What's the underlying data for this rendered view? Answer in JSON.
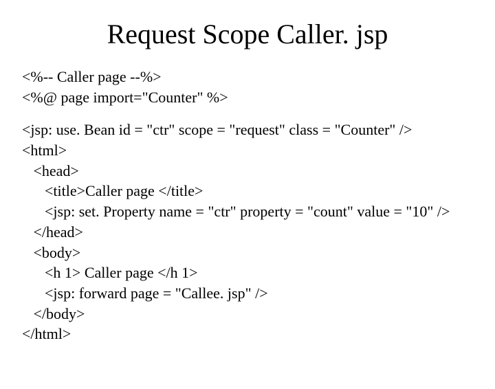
{
  "title": "Request Scope Caller. jsp",
  "code": {
    "l1": "<%-- Caller page --%>",
    "l2": "<%@ page import=\"Counter\" %>",
    "l3": "<jsp: use. Bean id = \"ctr\" scope = \"request\" class = \"Counter\" />",
    "l4": "<html>",
    "l5": "   <head>",
    "l6": "      <title>Caller page </title>",
    "l7": "      <jsp: set. Property name = \"ctr\" property = \"count\" value = \"10\" />",
    "l8": "   </head>",
    "l9": "   <body>",
    "l10": "      <h 1> Caller page </h 1>",
    "l11": "      <jsp: forward page = \"Callee. jsp\" />",
    "l12": "   </body>",
    "l13": "</html>"
  }
}
